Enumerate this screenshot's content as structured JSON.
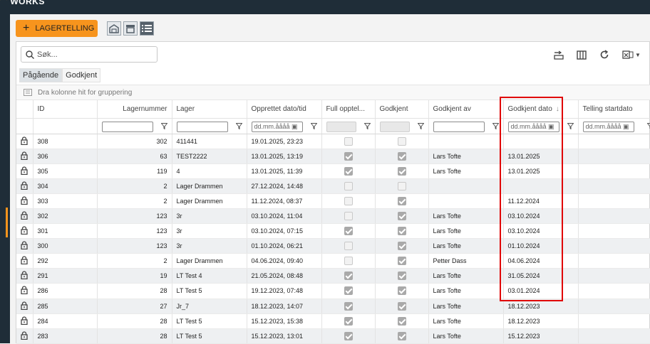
{
  "brand": {
    "line1": "",
    "line2": "WORKS"
  },
  "toolbar": {
    "add_button_label": "LAGERTELLING"
  },
  "search": {
    "placeholder": "Søk..."
  },
  "tabs": [
    {
      "label": "Pågående"
    },
    {
      "label": "Godkjent"
    }
  ],
  "group_hint": "Dra kolonne hit for gruppering",
  "columns": {
    "id": "ID",
    "lagernummer": "Lagernummer",
    "lager": "Lager",
    "opprettet": "Opprettet dato/tid",
    "full": "Full opptel...",
    "godkjent": "Godkjent",
    "godkjent_av": "Godkjent av",
    "godkjent_dato": "Godkjent dato",
    "telling_start": "Telling startdato"
  },
  "filters": {
    "date_placeholder": "dd.mm.åååå"
  },
  "rows": [
    {
      "id": "308",
      "lagernummer": "302",
      "lager": "411441",
      "opprettet": "19.01.2025, 23:23",
      "full": false,
      "full_checked": false,
      "godkjent": false,
      "godkjent_av": "",
      "godkjent_dato": ""
    },
    {
      "id": "306",
      "lagernummer": "63",
      "lager": "TEST2222",
      "opprettet": "13.01.2025, 13:19",
      "full_checked": true,
      "godkjent": true,
      "godkjent_av": "Lars Tofte",
      "godkjent_dato": "13.01.2025"
    },
    {
      "id": "305",
      "lagernummer": "119",
      "lager": "4",
      "opprettet": "13.01.2025, 11:39",
      "full_checked": true,
      "godkjent": true,
      "godkjent_av": "Lars Tofte",
      "godkjent_dato": "13.01.2025"
    },
    {
      "id": "304",
      "lagernummer": "2",
      "lager": "Lager Drammen",
      "opprettet": "27.12.2024, 14:48",
      "full_checked": false,
      "godkjent": false,
      "godkjent_av": "",
      "godkjent_dato": ""
    },
    {
      "id": "303",
      "lagernummer": "2",
      "lager": "Lager Drammen",
      "opprettet": "11.12.2024, 08:37",
      "full_checked": false,
      "godkjent": true,
      "godkjent_av": "",
      "godkjent_dato": "11.12.2024"
    },
    {
      "id": "302",
      "lagernummer": "123",
      "lager": "3r",
      "opprettet": "03.10.2024, 11:04",
      "full_checked": false,
      "godkjent": true,
      "godkjent_av": "Lars Tofte",
      "godkjent_dato": "03.10.2024"
    },
    {
      "id": "301",
      "lagernummer": "123",
      "lager": "3r",
      "opprettet": "03.10.2024, 07:15",
      "full_checked": true,
      "godkjent": true,
      "godkjent_av": "Lars Tofte",
      "godkjent_dato": "03.10.2024"
    },
    {
      "id": "300",
      "lagernummer": "123",
      "lager": "3r",
      "opprettet": "01.10.2024, 06:21",
      "full_checked": false,
      "godkjent": true,
      "godkjent_av": "Lars Tofte",
      "godkjent_dato": "01.10.2024"
    },
    {
      "id": "292",
      "lagernummer": "2",
      "lager": "Lager Drammen",
      "opprettet": "04.06.2024, 09:40",
      "full_checked": false,
      "godkjent": true,
      "godkjent_av": "Petter Dass",
      "godkjent_dato": "04.06.2024"
    },
    {
      "id": "291",
      "lagernummer": "19",
      "lager": "LT Test 4",
      "opprettet": "21.05.2024, 08:48",
      "full_checked": true,
      "godkjent": true,
      "godkjent_av": "Lars Tofte",
      "godkjent_dato": "31.05.2024"
    },
    {
      "id": "286",
      "lagernummer": "28",
      "lager": "LT Test 5",
      "opprettet": "19.12.2023, 07:48",
      "full_checked": true,
      "godkjent": true,
      "godkjent_av": "Lars Tofte",
      "godkjent_dato": "03.01.2024"
    },
    {
      "id": "285",
      "lagernummer": "27",
      "lager": "Jr_7",
      "opprettet": "18.12.2023, 14:07",
      "full_checked": true,
      "godkjent": true,
      "godkjent_av": "Lars Tofte",
      "godkjent_dato": "18.12.2023"
    },
    {
      "id": "284",
      "lagernummer": "28",
      "lager": "LT Test 5",
      "opprettet": "15.12.2023, 15:38",
      "full_checked": true,
      "godkjent": true,
      "godkjent_av": "Lars Tofte",
      "godkjent_dato": "18.12.2023"
    },
    {
      "id": "283",
      "lagernummer": "28",
      "lager": "LT Test 5",
      "opprettet": "15.12.2023, 13:01",
      "full_checked": true,
      "godkjent": true,
      "godkjent_av": "Lars Tofte",
      "godkjent_dato": "15.12.2023"
    }
  ],
  "colors": {
    "accent": "#f7941d",
    "topbar": "#1f2d38",
    "highlight": "#e00000"
  }
}
